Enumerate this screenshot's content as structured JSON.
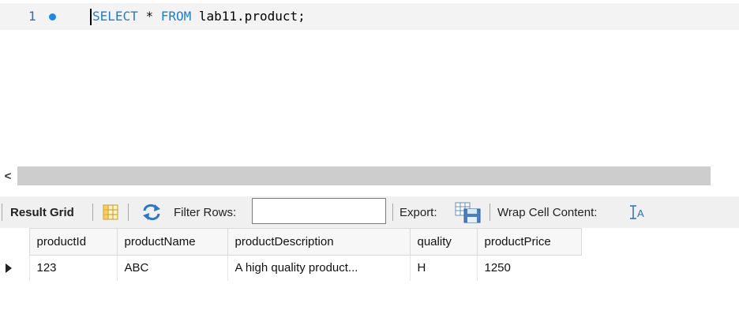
{
  "editor": {
    "line_number": "1",
    "tokens": [
      {
        "text": "SELECT",
        "type": "keyword"
      },
      {
        "text": " ",
        "type": "space"
      },
      {
        "text": "*",
        "type": "operator"
      },
      {
        "text": " ",
        "type": "space"
      },
      {
        "text": "FROM",
        "type": "keyword"
      },
      {
        "text": " lab11.product;",
        "type": "identifier"
      }
    ],
    "colors": {
      "keyword": "#1f7ec7",
      "line_number": "#2a6fb8",
      "statement_dot": "#1e88e5"
    }
  },
  "scrollbar": {
    "left_arrow": "<"
  },
  "toolbar": {
    "result_grid_label": "Result Grid",
    "filter_rows_label": "Filter Rows:",
    "filter_value": "",
    "export_label": "Export:",
    "wrap_label": "Wrap Cell Content:",
    "icons": [
      "grid-layout-icon",
      "refresh-icon",
      "export-icon",
      "wrap-cell-icon"
    ]
  },
  "grid": {
    "columns": [
      "productId",
      "productName",
      "productDescription",
      "quality",
      "productPrice"
    ],
    "rows": [
      [
        "123",
        "ABC",
        "A high quality product...",
        "H",
        "1250"
      ]
    ]
  }
}
